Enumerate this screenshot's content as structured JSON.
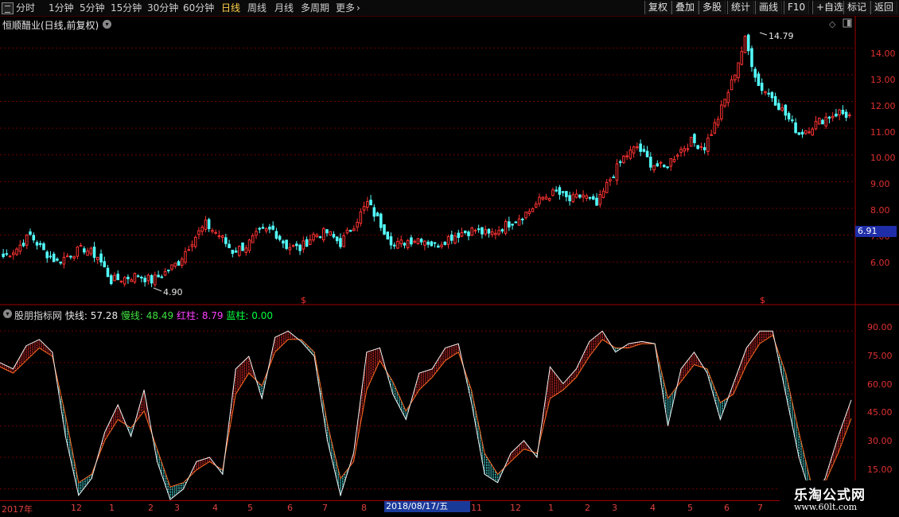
{
  "toolbar": {
    "periods": [
      "分时",
      "1分钟",
      "5分钟",
      "15分钟",
      "30分钟",
      "60分钟",
      "日线",
      "周线",
      "月线",
      "多周期",
      "更多"
    ],
    "active_period": "日线",
    "more_chevron": "›",
    "right_buttons": [
      "复权",
      "叠加",
      "多股",
      "统计",
      "画线",
      "F10",
      "+自选",
      "标记",
      "返回"
    ]
  },
  "stock": {
    "title": "恒顺醋业(日线,前复权)",
    "price_axis": [
      "14.00",
      "13.00",
      "12.00",
      "11.00",
      "10.00",
      "9.00",
      "8.00",
      "7.00",
      "6.00"
    ],
    "high_label": "14.79",
    "low_label": "4.90",
    "current_price_flag": "6.91",
    "event_marker": "$"
  },
  "indicator": {
    "name": "股朋指标网",
    "fast_label": "快线:",
    "fast_value": "57.28",
    "slow_label": "慢线:",
    "slow_value": "48.49",
    "red_label": "红柱:",
    "red_value": "8.79",
    "blue_label": "蓝柱:",
    "blue_value": "0.00",
    "axis": [
      "90.00",
      "75.00",
      "60.00",
      "45.00",
      "30.00",
      "15.00"
    ]
  },
  "date_axis": {
    "ticks": [
      "2017年",
      "12",
      "1",
      "2",
      "3",
      "4",
      "5",
      "6",
      "7",
      "8",
      "11",
      "12",
      "1",
      "2",
      "3",
      "4",
      "5",
      "6",
      "7"
    ],
    "cursor_label": "2018/08/17/五"
  },
  "watermark": {
    "title": "乐淘公式网",
    "url": "www.60lt.com"
  },
  "colors": {
    "background": "#000000",
    "up": "#ff3232",
    "down": "#54ffff",
    "grid": "#6e0000",
    "axis_text": "#e03030",
    "accent": "#ffd24a"
  },
  "chart_data": [
    {
      "type": "candlestick",
      "title": "恒顺醋业(日线,前复权)",
      "ylim": [
        4.4,
        15.2
      ],
      "y_ticks": [
        6,
        7,
        8,
        9,
        10,
        11,
        12,
        13,
        14
      ],
      "highest": 14.79,
      "lowest": 4.9,
      "close_trend": [
        6.2,
        6.5,
        7.0,
        6.4,
        6.0,
        6.3,
        6.5,
        6.2,
        5.3,
        5.4,
        5.5,
        5.3,
        5.6,
        6.0,
        6.8,
        7.4,
        7.0,
        6.4,
        6.6,
        7.1,
        7.2,
        6.6,
        6.5,
        7.0,
        7.1,
        6.7,
        7.4,
        8.2,
        7.4,
        6.6,
        6.8,
        6.9,
        6.6,
        6.9,
        7.1,
        7.2,
        7.0,
        7.3,
        7.6,
        7.9,
        8.4,
        8.6,
        8.3,
        8.5,
        8.1,
        9.1,
        9.9,
        10.3,
        9.7,
        9.5,
        10.1,
        10.5,
        10.3,
        11.4,
        12.7,
        14.3,
        12.6,
        12.2,
        11.5,
        10.8,
        11.1,
        11.4,
        11.6,
        11.4
      ]
    },
    {
      "type": "line",
      "title": "股朋指标网",
      "ylim": [
        10,
        98
      ],
      "y_ticks": [
        15,
        30,
        45,
        60,
        75,
        90
      ],
      "series": [
        {
          "name": "快线",
          "values": [
            75,
            72,
            83,
            86,
            80,
            40,
            12,
            20,
            42,
            55,
            40,
            62,
            28,
            10,
            15,
            28,
            30,
            22,
            72,
            78,
            58,
            87,
            90,
            85,
            78,
            38,
            12,
            32,
            80,
            82,
            60,
            48,
            70,
            72,
            82,
            84,
            56,
            22,
            18,
            32,
            38,
            30,
            73,
            65,
            72,
            85,
            90,
            80,
            84,
            85,
            84,
            45,
            72,
            80,
            70,
            48,
            65,
            82,
            90,
            90,
            60,
            30,
            10,
            20,
            40,
            57.28
          ]
        },
        {
          "name": "慢线",
          "values": [
            73,
            70,
            76,
            82,
            78,
            50,
            18,
            22,
            38,
            48,
            44,
            52,
            34,
            16,
            18,
            24,
            28,
            24,
            60,
            70,
            64,
            80,
            86,
            86,
            80,
            46,
            20,
            28,
            62,
            76,
            66,
            52,
            62,
            68,
            76,
            80,
            62,
            32,
            22,
            28,
            34,
            32,
            58,
            62,
            68,
            78,
            86,
            82,
            82,
            84,
            84,
            58,
            66,
            74,
            72,
            56,
            60,
            74,
            84,
            88,
            70,
            42,
            16,
            18,
            32,
            48.49
          ]
        }
      ]
    }
  ]
}
